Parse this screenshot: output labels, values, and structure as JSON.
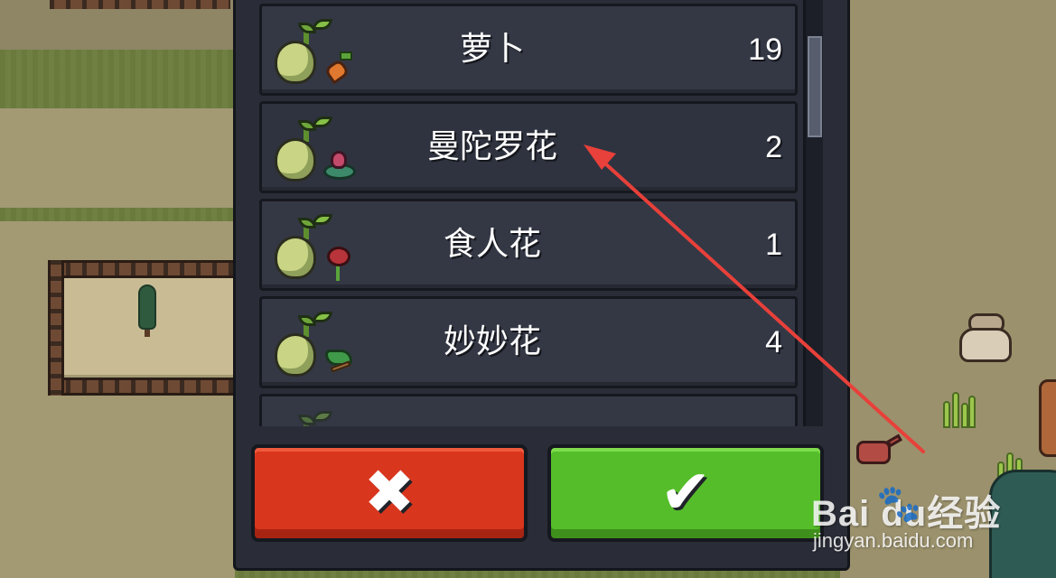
{
  "seed_list": {
    "items": [
      {
        "name": "萝卜",
        "count": "19",
        "crop_icon": "carrot-icon"
      },
      {
        "name": "曼陀罗花",
        "count": "2",
        "crop_icon": "mandrake-flower-icon"
      },
      {
        "name": "食人花",
        "count": "1",
        "crop_icon": "man-eater-flower-icon"
      },
      {
        "name": "妙妙花",
        "count": "4",
        "crop_icon": "vine-flower-icon"
      }
    ]
  },
  "buttons": {
    "cancel_glyph": "✖",
    "confirm_glyph": "✔",
    "cancel_color": "#d9361e",
    "confirm_color": "#55bd2a"
  },
  "annotation": {
    "arrow_color": "#e8403a"
  },
  "watermark": {
    "brand": "Bai  du经验",
    "url": "jingyan.baidu.com"
  }
}
